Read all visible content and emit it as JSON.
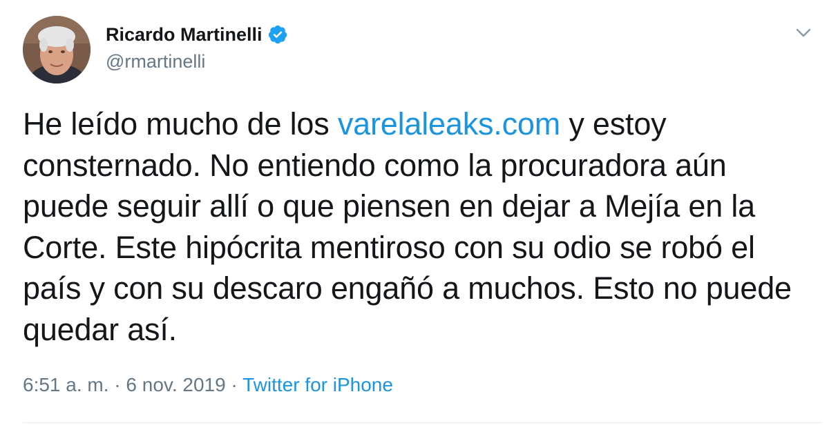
{
  "user": {
    "display_name": "Ricardo Martinelli",
    "handle": "@rmartinelli",
    "verified": true
  },
  "tweet": {
    "text_before_link": "He leído mucho de los ",
    "link_text": "varelaleaks.com",
    "text_after_link": " y estoy consternado. No entiendo como la procuradora aún puede seguir allí o que piensen en dejar a Mejía en la Corte. Este hipócrita mentiroso con su odio se robó el país y con su descaro engañó a muchos. Esto no puede quedar así."
  },
  "meta": {
    "time": "6:51 a. m.",
    "separator": " · ",
    "date": "6 nov. 2019",
    "source": "Twitter for iPhone"
  },
  "icons": {
    "verified": "verified-badge-icon",
    "menu": "chevron-down-icon"
  },
  "colors": {
    "link": "#1b95e0",
    "secondary_text": "#657786",
    "primary_text": "#14171a",
    "verified_badge": "#1da1f2",
    "divider": "#e6ecf0"
  }
}
